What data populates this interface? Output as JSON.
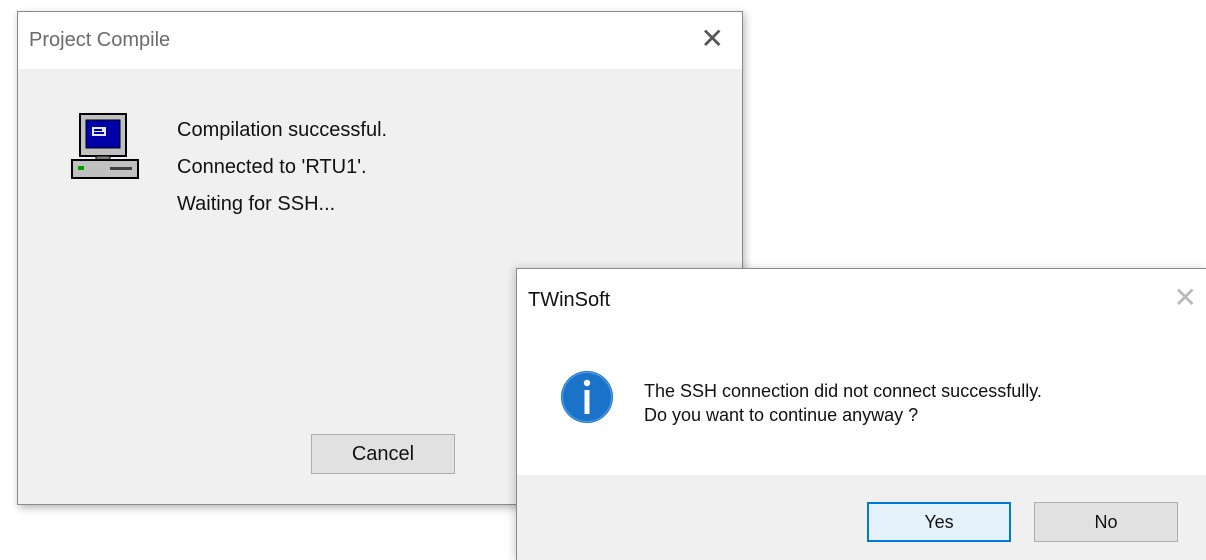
{
  "compile_dialog": {
    "title": "Project Compile",
    "close_glyph": "✕",
    "icon": "computer-icon",
    "lines": [
      "Compilation successful.",
      "Connected to 'RTU1'.",
      "Waiting for SSH..."
    ],
    "cancel_label": "Cancel"
  },
  "twinsoft_dialog": {
    "title": "TWinSoft",
    "close_glyph": "✕",
    "icon": "info-icon",
    "message_lines": [
      "The SSH connection did not connect successfully.",
      "Do you want to continue anyway ?"
    ],
    "yes_label": "Yes",
    "no_label": "No"
  },
  "colors": {
    "dialog_body": "#f0f0f0",
    "info_blue": "#1a73c8",
    "focus_border": "#0078d7"
  }
}
